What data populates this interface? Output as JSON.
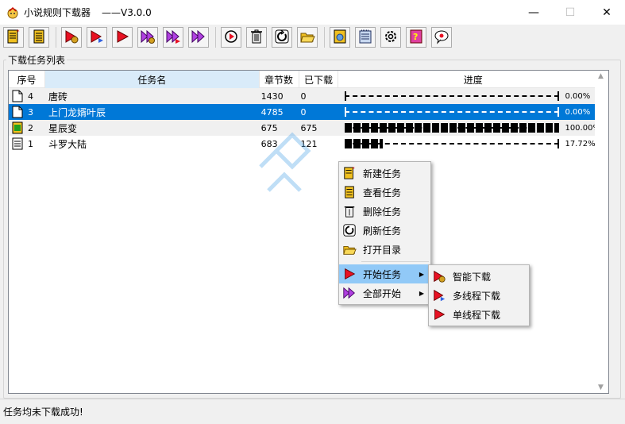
{
  "window": {
    "title": "小说规则下载器",
    "version": "——V3.0.0",
    "controls": {
      "minimize": "—",
      "maximize": "☐",
      "close": "✕"
    }
  },
  "toolbar": {
    "buttons": [
      {
        "icon": "new-task-icon",
        "tooltip": ""
      },
      {
        "icon": "view-task-icon",
        "tooltip": ""
      },
      {
        "icon": "smart-download-icon",
        "tooltip": ""
      },
      {
        "icon": "multi-thread-download-icon",
        "tooltip": ""
      },
      {
        "icon": "single-thread-download-icon",
        "tooltip": ""
      },
      {
        "icon": "smart-download-all-icon",
        "tooltip": ""
      },
      {
        "icon": "multi-thread-download-all-icon",
        "tooltip": ""
      },
      {
        "icon": "start-all-icon",
        "tooltip": ""
      },
      {
        "icon": "reload-play-icon",
        "tooltip": ""
      },
      {
        "icon": "trash-icon",
        "tooltip": ""
      },
      {
        "icon": "refresh-icon",
        "tooltip": ""
      },
      {
        "icon": "folder-icon",
        "tooltip": ""
      },
      {
        "icon": "export-icon",
        "tooltip": ""
      },
      {
        "icon": "notepad-icon",
        "tooltip": ""
      },
      {
        "icon": "gear-icon",
        "tooltip": ""
      },
      {
        "icon": "help-icon",
        "tooltip": ""
      },
      {
        "icon": "chat-icon",
        "tooltip": ""
      }
    ]
  },
  "task_list": {
    "group_title": "下载任务列表",
    "headers": {
      "index": "序号",
      "name": "任务名",
      "chapters": "章节数",
      "downloaded": "已下载",
      "progress": "进度"
    },
    "rows": [
      {
        "index": "4",
        "name": "唐砖",
        "chapters": "1430",
        "downloaded": "0",
        "progress": 0.0,
        "progress_text": "0.00%",
        "icon": "document-icon",
        "selected": false
      },
      {
        "index": "3",
        "name": "上门龙婿叶辰",
        "chapters": "4785",
        "downloaded": "0",
        "progress": 0.0,
        "progress_text": "0.00%",
        "icon": "document-icon",
        "selected": true
      },
      {
        "index": "2",
        "name": "星辰变",
        "chapters": "675",
        "downloaded": "675",
        "progress": 1.0,
        "progress_text": "100.00%",
        "icon": "completed-book-icon",
        "selected": false
      },
      {
        "index": "1",
        "name": "斗罗大陆",
        "chapters": "683",
        "downloaded": "121",
        "progress": 0.1772,
        "progress_text": "17.72%",
        "icon": "notebook-icon",
        "selected": false
      }
    ]
  },
  "context_menu": {
    "items": [
      {
        "label": "新建任务",
        "icon": "new-task-icon"
      },
      {
        "label": "查看任务",
        "icon": "view-task-icon"
      },
      {
        "label": "删除任务",
        "icon": "trash-icon"
      },
      {
        "label": "刷新任务",
        "icon": "refresh-icon"
      },
      {
        "label": "打开目录",
        "icon": "folder-icon"
      },
      {
        "label": "开始任务",
        "icon": "play-icon",
        "submenu": true
      },
      {
        "label": "全部开始",
        "icon": "start-all-icon",
        "submenu": true
      }
    ],
    "submenu": [
      {
        "label": "智能下载",
        "icon": "smart-download-icon"
      },
      {
        "label": "多线程下载",
        "icon": "multi-thread-download-icon"
      },
      {
        "label": "单线程下载",
        "icon": "single-thread-download-icon"
      }
    ]
  },
  "status": {
    "message": "任务均未下载成功!"
  },
  "colors": {
    "selection": "#0078d7",
    "menu_highlight": "#91c9f7",
    "play_red": "#e81123",
    "play_purple": "#b040e0",
    "book_yellow": "#f0c020"
  }
}
